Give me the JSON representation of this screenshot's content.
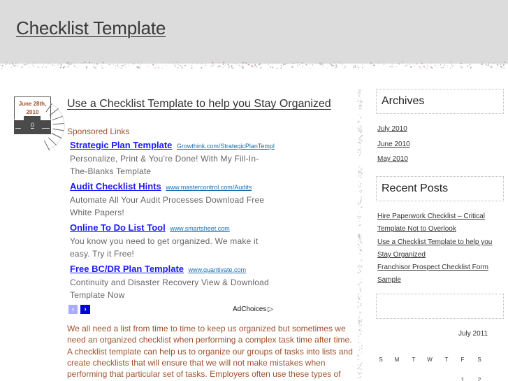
{
  "header": {
    "site_title": "Checklist Template"
  },
  "post": {
    "date": "June 28th, 2010",
    "date_line1": "June 28th,",
    "date_line2": "2010",
    "comment_count": "0",
    "title": "Use a Checklist Template to help you Stay Organized",
    "body": "We all need a list from time to time to keep us organized but sometimes we need an organized checklist when performing a complex task time after time. A checklist template can help us to organize our groups of tasks into lists and create checklists that will ensure that we will not make mistakes when performing that particular set of tasks. Employers often use these types of checklists to help their employees make sure they complete all the work that"
  },
  "ads": {
    "label": "Sponsored Links",
    "items": [
      {
        "title": "Strategic Plan Template",
        "url": "Growthink.com/StrategicPlanTempl",
        "description": "Personalize, Print & You're Done! With My Fill-In-The-Blanks Template"
      },
      {
        "title": "Audit Checklist Hints",
        "url": "www.mastercontrol.com/Audits",
        "description": "Automate All Your Audit Processes Download Free White Papers!"
      },
      {
        "title": "Online To Do List Tool",
        "url": "www.smartsheet.com",
        "description": "You know you need to get organized. We make it easy. Try it Free!"
      },
      {
        "title": "Free BC/DR Plan Template",
        "url": "www.quantivate.com",
        "description": "Continuity and Disaster Recovery View & Download Template Now"
      }
    ],
    "prev_icon": "‹",
    "next_icon": "›",
    "adchoices_label": "AdChoices",
    "adchoices_icon": "▷"
  },
  "sidebar": {
    "archives": {
      "title": "Archives",
      "links": [
        "July 2010",
        "June 2010",
        "May 2010"
      ]
    },
    "recent_posts": {
      "title": "Recent Posts",
      "links": [
        "Hire Paperwork Checklist – Critical Template Not to Overlook",
        "Use a Checklist Template to help you Stay Organized",
        "Franchisor Prospect Checklist Form Sample"
      ]
    },
    "calendar": {
      "caption": "July 2011",
      "weekdays": [
        "S",
        "M",
        "T",
        "W",
        "T",
        "F",
        "S"
      ],
      "first_row": [
        "",
        "",
        "",
        "",
        "",
        "1",
        "2"
      ]
    }
  }
}
